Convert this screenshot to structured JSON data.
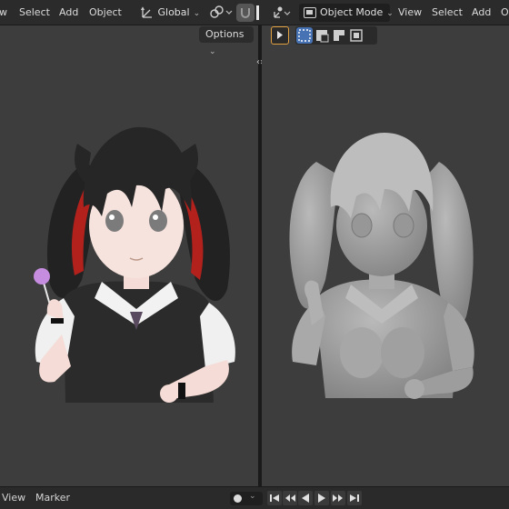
{
  "header": {
    "left_menu": [
      "w",
      "Select",
      "Add",
      "Object"
    ],
    "transform_orientation": "Global",
    "right_mode": "Object Mode",
    "right_menu": [
      "View",
      "Select",
      "Add",
      "O"
    ]
  },
  "left_viewport": {
    "options_label": "Options"
  },
  "footer": {
    "view_label": "View",
    "marker_label": "Marker"
  },
  "colors": {
    "viewport_bg": "#3d3d3d",
    "header_bg": "#2b2b2b",
    "accent_blue": "#4772b3",
    "select_orange": "#e0a040"
  }
}
